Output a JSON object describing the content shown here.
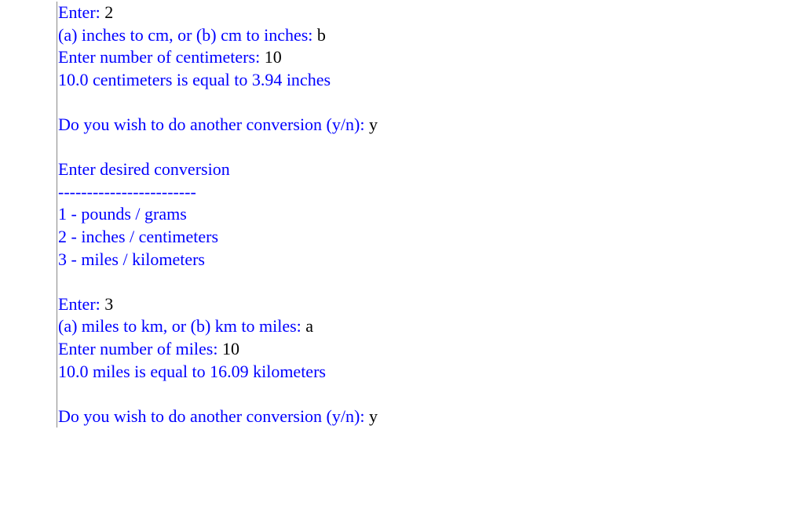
{
  "colors": {
    "prompt": "#0000ff",
    "input": "#000000",
    "border": "#888888"
  },
  "lines": [
    {
      "prompt": "Enter: ",
      "input": "2"
    },
    {
      "prompt": "(a) inches to cm, or (b) cm to inches: ",
      "input": "b"
    },
    {
      "prompt": "Enter number of centimeters: ",
      "input": "10"
    },
    {
      "output": "10.0 centimeters is equal to 3.94 inches"
    },
    {
      "blank": true
    },
    {
      "prompt": "Do you wish to do another conversion (y/n): ",
      "input": "y"
    },
    {
      "blank": true
    },
    {
      "output": "Enter desired conversion"
    },
    {
      "output": "------------------------"
    },
    {
      "output": "1 - pounds / grams"
    },
    {
      "output": "2 - inches / centimeters"
    },
    {
      "output": "3 - miles / kilometers"
    },
    {
      "blank": true
    },
    {
      "prompt": "Enter: ",
      "input": "3"
    },
    {
      "prompt": "(a) miles to km, or (b) km to miles: ",
      "input": "a"
    },
    {
      "prompt": "Enter number of miles: ",
      "input": "10"
    },
    {
      "output": "10.0 miles is equal to 16.09 kilometers"
    },
    {
      "blank": true
    },
    {
      "prompt": "Do you wish to do another conversion (y/n): ",
      "input": "y"
    }
  ]
}
